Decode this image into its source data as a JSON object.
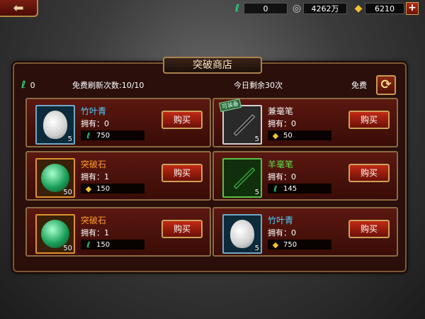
{
  "topbar": {
    "back_icon": "arrow-left-icon",
    "jade": "0",
    "silver": "4262万",
    "gold": "6210",
    "plus": "+"
  },
  "shop": {
    "title": "突破商店",
    "jade_count": "0",
    "free_refresh": "免费刷新次数:10/10",
    "today_left": "今日剩余30次",
    "free_label": "免费",
    "refresh_icon": "refresh-icon"
  },
  "items": [
    {
      "name": "竹叶青",
      "own": "拥有：0",
      "qty": "5",
      "price": "750",
      "currency": "jade",
      "buy": "购买",
      "tag": ""
    },
    {
      "name": "兼毫笔",
      "own": "拥有：0",
      "qty": "5",
      "price": "50",
      "currency": "gold",
      "buy": "购买",
      "tag": "可装备"
    },
    {
      "name": "突破石",
      "own": "拥有：1",
      "qty": "50",
      "price": "150",
      "currency": "gold",
      "buy": "购买",
      "tag": ""
    },
    {
      "name": "羊毫笔",
      "own": "拥有：0",
      "qty": "5",
      "price": "145",
      "currency": "jade",
      "buy": "购买",
      "tag": ""
    },
    {
      "name": "突破石",
      "own": "拥有：1",
      "qty": "50",
      "price": "150",
      "currency": "jade",
      "buy": "购买",
      "tag": ""
    },
    {
      "name": "竹叶青",
      "own": "拥有：0",
      "qty": "5",
      "price": "750",
      "currency": "gold",
      "buy": "购买",
      "tag": ""
    }
  ],
  "colors": {
    "jade": "#2fd07a",
    "gold": "#f2c12e",
    "buy_button": "#c12a15",
    "panel_border": "#8b6b43"
  }
}
